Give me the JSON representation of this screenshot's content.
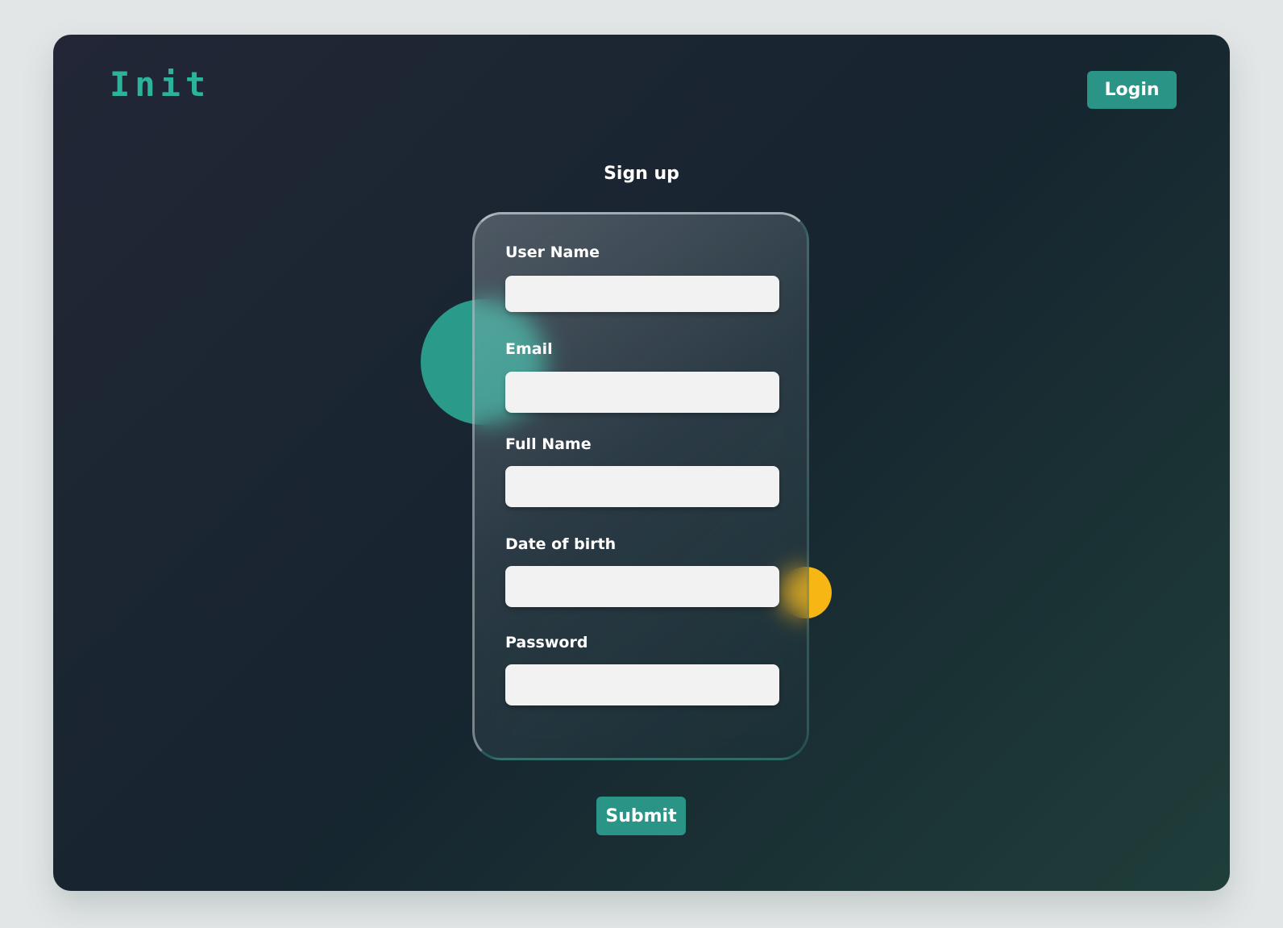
{
  "header": {
    "logo_text": "Init",
    "login_label": "Login"
  },
  "form": {
    "title": "Sign up",
    "fields": [
      {
        "label": "User Name",
        "value": ""
      },
      {
        "label": "Email",
        "value": ""
      },
      {
        "label": "Full Name",
        "value": ""
      },
      {
        "label": "Date of birth",
        "value": ""
      },
      {
        "label": "Password",
        "value": ""
      }
    ],
    "submit_label": "Submit"
  },
  "colors": {
    "accent": "#2a9486",
    "logo": "#2bb39c",
    "highlight": "#f7b614",
    "input_bg": "#f2f2f2"
  }
}
